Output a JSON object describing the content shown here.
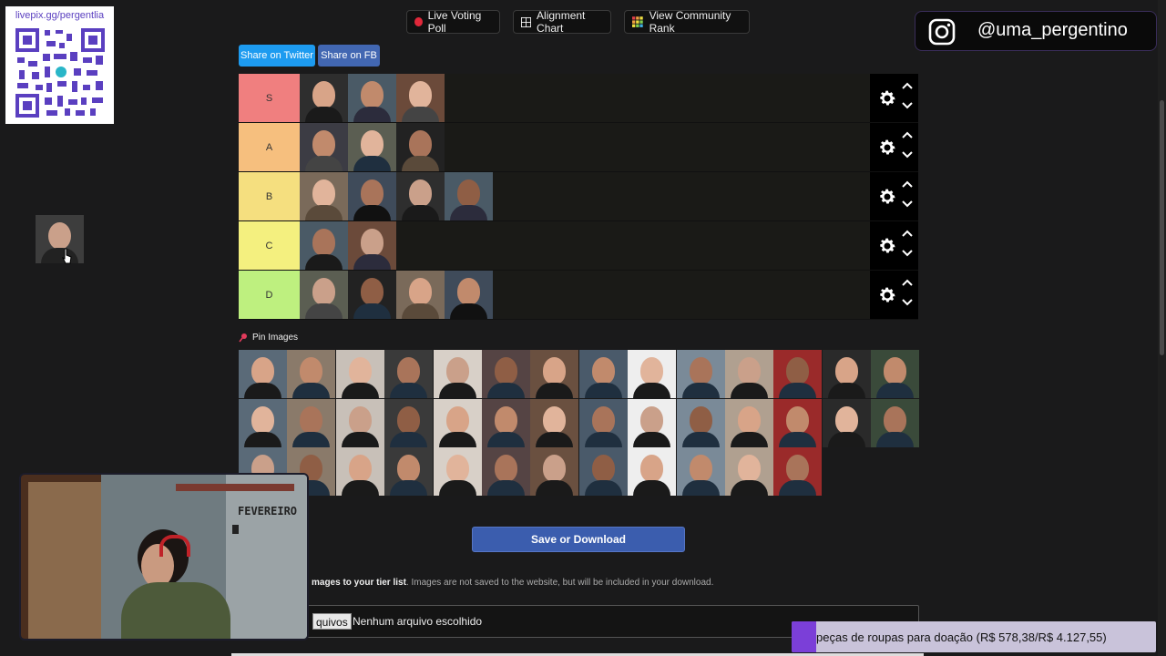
{
  "qr": {
    "label": "livepix.gg/pergentlia"
  },
  "top_buttons": {
    "poll": "Live Voting Poll",
    "alignment": "Alignment Chart",
    "rank": "View Community Rank"
  },
  "instagram": {
    "handle": "@uma_pergentino"
  },
  "share": {
    "twitter": "Share on Twitter",
    "fb": "Share on FB"
  },
  "tiers": [
    {
      "label": "S",
      "color": "#f07f7f",
      "count": 3
    },
    {
      "label": "A",
      "color": "#f6bf7e",
      "count": 3
    },
    {
      "label": "B",
      "color": "#f5df7f",
      "count": 4
    },
    {
      "label": "C",
      "color": "#f4f07f",
      "count": 2
    },
    {
      "label": "D",
      "color": "#bef07f",
      "count": 4
    }
  ],
  "pin": {
    "label": "Pin Images",
    "count": 40
  },
  "save": {
    "label": "Save or Download"
  },
  "upload": {
    "bold": "mages to your tier list",
    "rest": ". Images are not saved to the website, but will be included in your download.",
    "button": "quivos",
    "status": "Nenhum arquivo escolhido"
  },
  "webcam": {
    "sign": "FEVEREIRO"
  },
  "goal": {
    "text": "peças de roupas para doação (R$ 578,38/R$ 4.127,55)"
  }
}
